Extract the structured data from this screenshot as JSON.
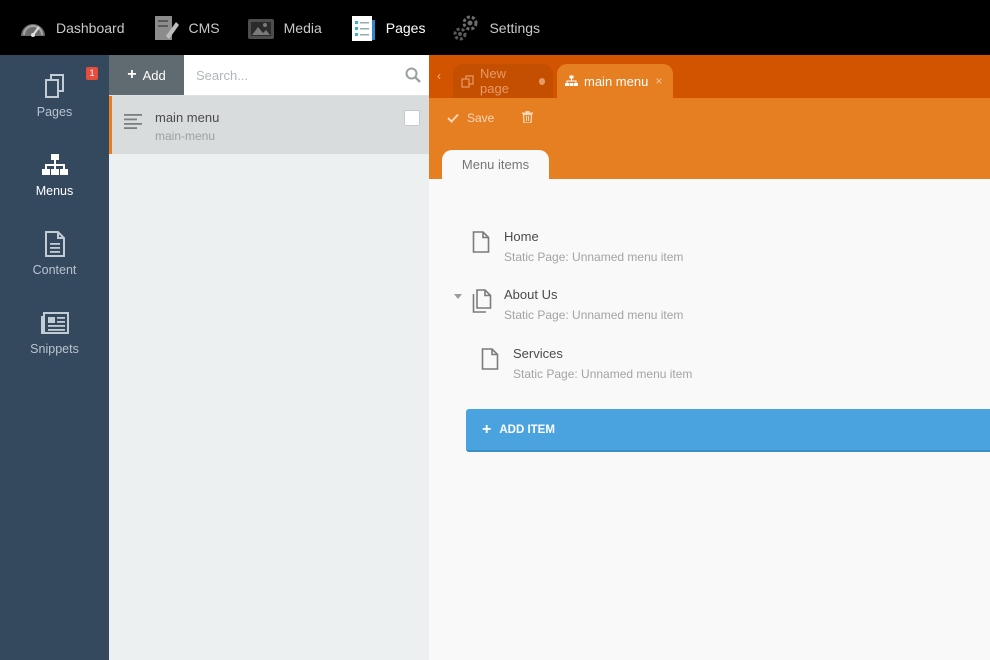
{
  "topnav": [
    {
      "label": "Dashboard",
      "icon": "dashboard-icon",
      "active": false
    },
    {
      "label": "CMS",
      "icon": "cms-icon",
      "active": false
    },
    {
      "label": "Media",
      "icon": "media-icon",
      "active": false
    },
    {
      "label": "Pages",
      "icon": "pages-icon",
      "active": true
    },
    {
      "label": "Settings",
      "icon": "settings-icon",
      "active": false
    }
  ],
  "sidebar": {
    "items": [
      {
        "label": "Pages",
        "icon": "pages-icon",
        "badge": "1",
        "active": false
      },
      {
        "label": "Menus",
        "icon": "sitemap-icon",
        "active": true
      },
      {
        "label": "Content",
        "icon": "document-icon",
        "active": false
      },
      {
        "label": "Snippets",
        "icon": "newspaper-icon",
        "active": false
      }
    ]
  },
  "list": {
    "add_label": "Add",
    "search_placeholder": "Search...",
    "items": [
      {
        "title": "main menu",
        "subtitle": "main-menu"
      }
    ]
  },
  "tabs": [
    {
      "label": "New page",
      "icon": "pages-icon",
      "modified": true,
      "active": false
    },
    {
      "label": "main menu",
      "icon": "sitemap-icon",
      "close": "×",
      "active": true
    }
  ],
  "toolbar": {
    "save_label": "Save",
    "delete_icon": "trash-icon"
  },
  "subtab": {
    "label": "Menu items"
  },
  "menu_items": [
    {
      "title": "Home",
      "subtitle": "Static Page: Unnamed menu item",
      "icon": "file-icon"
    },
    {
      "title": "About Us",
      "subtitle": "Static Page: Unnamed menu item",
      "icon": "files-icon",
      "expanded": true
    },
    {
      "title": "Services",
      "subtitle": "Static Page: Unnamed menu item",
      "icon": "file-icon"
    }
  ],
  "add_item_label": "ADD ITEM",
  "colors": {
    "topbar": "#000000",
    "sidebar": "#34495e",
    "accent_orange": "#e67e22",
    "tab_orange_dark": "#d35400",
    "add_item_blue": "#4aa3df",
    "badge_red": "#e74c3c"
  }
}
